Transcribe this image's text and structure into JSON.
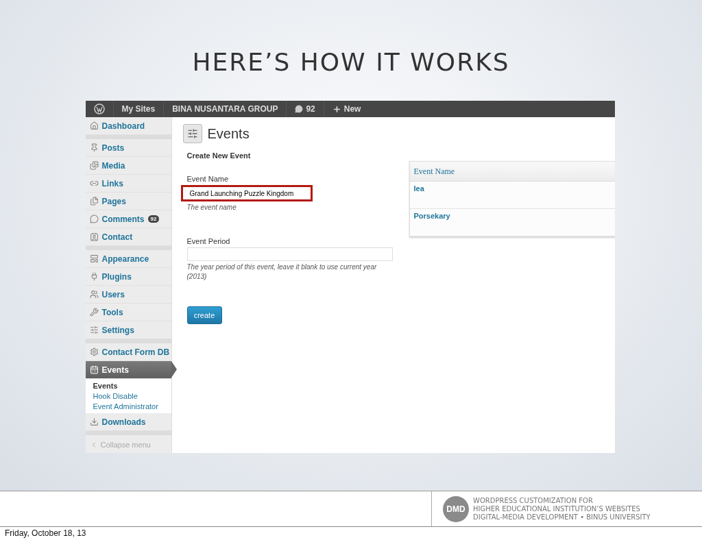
{
  "slide_title": "HERE’S HOW IT WORKS",
  "admin_bar": {
    "items": [
      {
        "kind": "logo"
      },
      {
        "kind": "text",
        "label": "My Sites"
      },
      {
        "kind": "text",
        "label": "BINA NUSANTARA GROUP"
      },
      {
        "kind": "comments",
        "label": "92"
      },
      {
        "kind": "new",
        "label": "New"
      }
    ]
  },
  "sidebar": {
    "groups": [
      [
        {
          "label": "Dashboard",
          "kind": "home",
          "selected": false
        }
      ],
      [
        {
          "label": "Posts",
          "kind": "pin",
          "selected": false
        },
        {
          "label": "Media",
          "kind": "media",
          "selected": false
        },
        {
          "label": "Links",
          "kind": "link",
          "selected": false
        },
        {
          "label": "Pages",
          "kind": "pages",
          "selected": false
        },
        {
          "label": "Comments",
          "kind": "comment",
          "selected": false,
          "badge": "92"
        },
        {
          "label": "Contact",
          "kind": "contact",
          "selected": false
        }
      ],
      [
        {
          "label": "Appearance",
          "kind": "appearance",
          "selected": false
        },
        {
          "label": "Plugins",
          "kind": "plug",
          "selected": false
        },
        {
          "label": "Users",
          "kind": "users",
          "selected": false
        },
        {
          "label": "Tools",
          "kind": "tools",
          "selected": false
        },
        {
          "label": "Settings",
          "kind": "settings",
          "selected": false
        }
      ],
      [
        {
          "label": "Contact Form DB",
          "kind": "gear",
          "selected": false
        },
        {
          "label": "Events",
          "kind": "calendar",
          "selected": true,
          "children": [
            {
              "label": "Events",
              "selected": true
            },
            {
              "label": "Hook Disable",
              "selected": false
            },
            {
              "label": "Event Administrator",
              "selected": false
            }
          ]
        },
        {
          "label": "Downloads",
          "kind": "download",
          "selected": false
        }
      ]
    ],
    "collapse": "Collapse menu"
  },
  "page": {
    "title": "Events",
    "section": "Create New Event",
    "fields": [
      {
        "label": "Event Name",
        "value": "Grand Launching Puzzle Kingdom",
        "hint": "The event name",
        "highlighted": true
      },
      {
        "label": "Event Period",
        "hint": "The year period of this event, leave it blank to use current year (2013)",
        "highlighted": false
      }
    ],
    "button": "create"
  },
  "table": {
    "columns": [
      "Event Name"
    ],
    "rows": [
      "Iea",
      "Porsekary"
    ]
  },
  "footer": {
    "logo": "DMD",
    "lines": [
      "WORDPRESS CUSTOMIZATION FOR",
      "HIGHER EDUCATIONAL INSTITUTION’S WEBSITES",
      "DIGITAL-MEDIA DEVELOPMENT • BINUS UNIVERSITY"
    ]
  },
  "date": "Friday, October 18, 13"
}
